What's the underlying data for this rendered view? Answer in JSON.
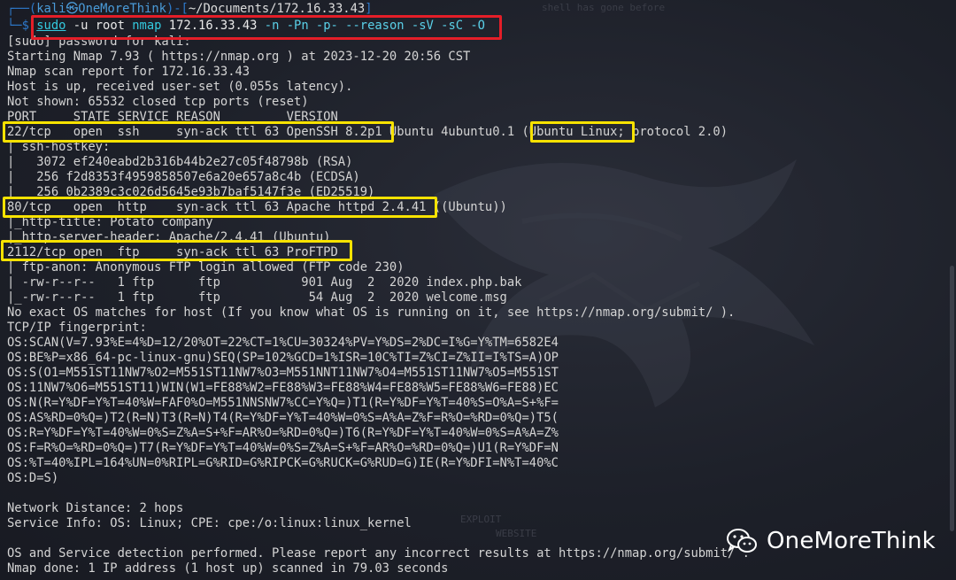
{
  "prompt": {
    "top_prefix": "┌──(",
    "user_host": "kali㉿OneMoreThink",
    "sep": ")-[",
    "path": "~/Documents/172.16.33.43",
    "end": "]",
    "bottom_prefix": "└─$ "
  },
  "command": {
    "sudo": "sudo",
    "p1": " -u ",
    "p2": "root",
    "p3": " ",
    "nmap": "nmap",
    "p4": " 172.16.33.43 ",
    "flags": "-n -Pn -p- --reason -sV -sC -O"
  },
  "lines": [
    "[sudo] password for kali:",
    "Starting Nmap 7.93 ( https://nmap.org ) at 2023-12-20 20:56 CST",
    "Nmap scan report for 172.16.33.43",
    "Host is up, received user-set (0.055s latency).",
    "Not shown: 65532 closed tcp ports (reset)",
    "PORT     STATE SERVICE REASON         VERSION",
    "22/tcp   open  ssh     syn-ack ttl 63 OpenSSH 8.2p1 Ubuntu 4ubuntu0.1 (Ubuntu Linux; protocol 2.0)",
    "| ssh-hostkey:",
    "|   3072 ef240eabd2b316b44b2e27c05f48798b (RSA)",
    "|   256 f2d8353f4959858507e6a20e657a8c4b (ECDSA)",
    "|_  256 0b2389c3c026d5645e93b7baf5147f3e (ED25519)",
    "80/tcp   open  http    syn-ack ttl 63 Apache httpd 2.4.41 ((Ubuntu))",
    "|_http-title: Potato company",
    "|_http-server-header: Apache/2.4.41 (Ubuntu)",
    "2112/tcp open  ftp     syn-ack ttl 63 ProFTPD",
    "| ftp-anon: Anonymous FTP login allowed (FTP code 230)",
    "| -rw-r--r--   1 ftp      ftp           901 Aug  2  2020 index.php.bak",
    "|_-rw-r--r--   1 ftp      ftp            54 Aug  2  2020 welcome.msg",
    "No exact OS matches for host (If you know what OS is running on it, see https://nmap.org/submit/ ).",
    "TCP/IP fingerprint:",
    "OS:SCAN(V=7.93%E=4%D=12/20%OT=22%CT=1%CU=30324%PV=Y%DS=2%DC=I%G=Y%TM=6582E4",
    "OS:BE%P=x86_64-pc-linux-gnu)SEQ(SP=102%GCD=1%ISR=10C%TI=Z%CI=Z%II=I%TS=A)OP",
    "OS:S(O1=M551ST11NW7%O2=M551ST11NW7%O3=M551NNT11NW7%O4=M551ST11NW7%O5=M551ST",
    "OS:11NW7%O6=M551ST11)WIN(W1=FE88%W2=FE88%W3=FE88%W4=FE88%W5=FE88%W6=FE88)EC",
    "OS:N(R=Y%DF=Y%T=40%W=FAF0%O=M551NNSNW7%CC=Y%Q=)T1(R=Y%DF=Y%T=40%S=O%A=S+%F=",
    "OS:AS%RD=0%Q=)T2(R=N)T3(R=N)T4(R=Y%DF=Y%T=40%W=0%S=A%A=Z%F=R%O=%RD=0%Q=)T5(",
    "OS:R=Y%DF=Y%T=40%W=0%S=Z%A=S+%F=AR%O=%RD=0%Q=)T6(R=Y%DF=Y%T=40%W=0%S=A%A=Z%",
    "OS:F=R%O=%RD=0%Q=)T7(R=Y%DF=Y%T=40%W=0%S=Z%A=S+%F=AR%O=%RD=0%Q=)U1(R=Y%DF=N",
    "OS:%T=40%IPL=164%UN=0%RIPL=G%RID=G%RIPCK=G%RUCK=G%RUD=G)IE(R=Y%DFI=N%T=40%C",
    "OS:D=S)",
    "",
    "Network Distance: 2 hops",
    "Service Info: OS: Linux; CPE: cpe:/o:linux:linux_kernel",
    "",
    "OS and Service detection performed. Please report any incorrect results at https://nmap.org/submit/ .",
    "Nmap done: 1 IP address (1 host up) scanned in 79.03 seconds"
  ],
  "watermark": {
    "brand": "OneMoreThink",
    "icon": "wechat-icon",
    "bg_text_top": "shell has gone before",
    "bg_text_bottom1": "EXPLOIT",
    "bg_text_bottom2": "WEBSITE"
  },
  "colors": {
    "background": "#1d2029",
    "highlight_red": "#e41e28",
    "highlight_yellow": "#f7e200",
    "prompt_blue": "#2d78c9",
    "command_cyan": "#33c9de"
  }
}
